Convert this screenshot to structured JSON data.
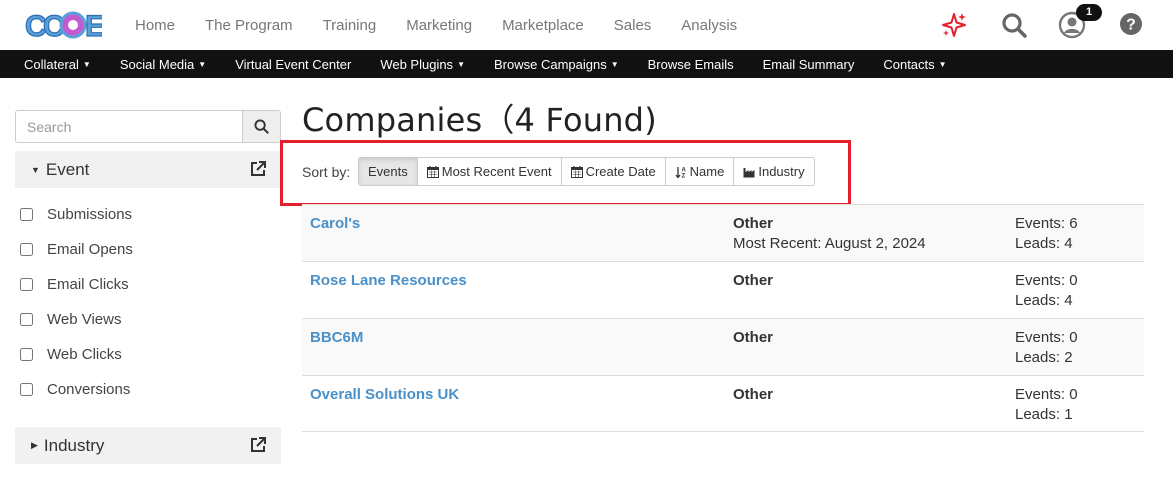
{
  "brand": {
    "logo_text": "CCOE"
  },
  "top_nav": {
    "items": [
      "Home",
      "The Program",
      "Training",
      "Marketing",
      "Marketplace",
      "Sales",
      "Analysis"
    ],
    "notification_count": "1",
    "icons": [
      "sparkle-icon",
      "search-icon",
      "user-icon",
      "help-icon"
    ],
    "colors": {
      "sparkle": "#e3202b",
      "icons": "#666666"
    }
  },
  "sub_nav": {
    "items": [
      {
        "label": "Collateral",
        "dropdown": true
      },
      {
        "label": "Social Media",
        "dropdown": true
      },
      {
        "label": "Virtual Event Center",
        "dropdown": false
      },
      {
        "label": "Web Plugins",
        "dropdown": true
      },
      {
        "label": "Browse Campaigns",
        "dropdown": true
      },
      {
        "label": "Browse Emails",
        "dropdown": false
      },
      {
        "label": "Email Summary",
        "dropdown": false
      },
      {
        "label": "Contacts",
        "dropdown": true
      }
    ]
  },
  "sidebar": {
    "search_placeholder": "Search",
    "event_panel": {
      "title": "Event",
      "filters": [
        "Submissions",
        "Email Opens",
        "Email Clicks",
        "Web Views",
        "Web Clicks",
        "Conversions"
      ]
    },
    "industry_panel": {
      "title": "Industry"
    }
  },
  "main": {
    "title": "Companies（4 Found)",
    "sort_label": "Sort by:",
    "sort_options": [
      {
        "label": "Events",
        "icon": "",
        "active": true
      },
      {
        "label": "Most Recent Event",
        "icon": "calendar-icon",
        "active": false
      },
      {
        "label": "Create Date",
        "icon": "calendar-icon",
        "active": false
      },
      {
        "label": "Name",
        "icon": "sort-alpha-icon",
        "active": false
      },
      {
        "label": "Industry",
        "icon": "industry-icon",
        "active": false
      }
    ],
    "companies": [
      {
        "name": "Carol's",
        "industry": "Other",
        "most_recent": "Most Recent: August 2, 2024",
        "events": "Events: 6",
        "leads": "Leads: 4"
      },
      {
        "name": "Rose Lane Resources",
        "industry": "Other",
        "most_recent": "",
        "events": "Events: 0",
        "leads": "Leads: 4"
      },
      {
        "name": "BBC6M",
        "industry": "Other",
        "most_recent": "",
        "events": "Events: 0",
        "leads": "Leads: 2"
      },
      {
        "name": "Overall Solutions UK",
        "industry": "Other",
        "most_recent": "",
        "events": "Events: 0",
        "leads": "Leads: 1"
      }
    ],
    "link_color": "#4a90c9",
    "highlight_color": "#e3202b"
  }
}
